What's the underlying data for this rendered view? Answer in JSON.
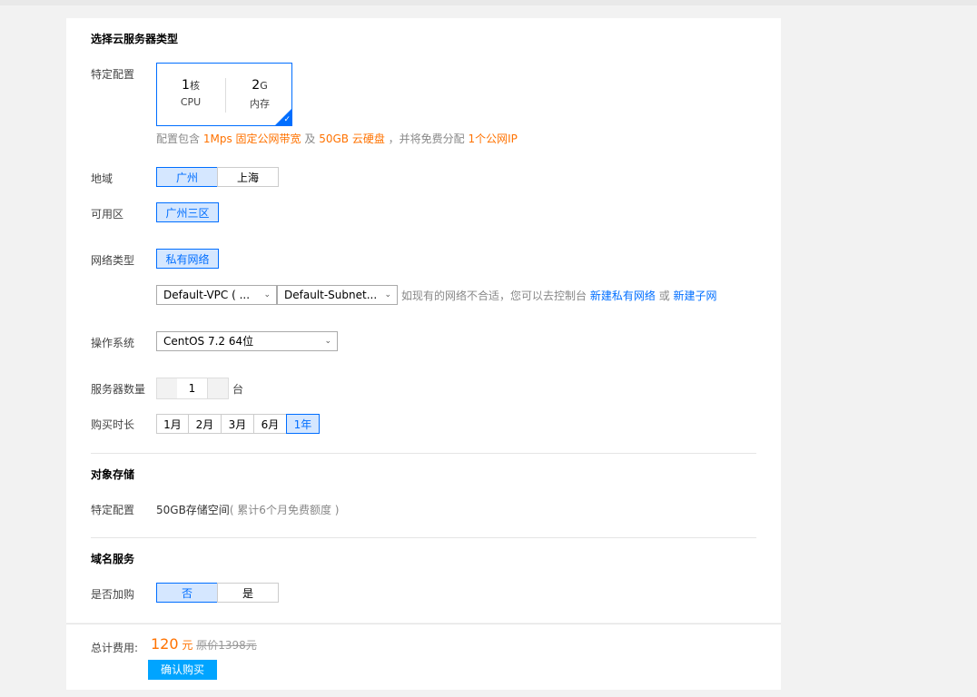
{
  "server": {
    "title": "选择云服务器类型",
    "spec_label": "特定配置",
    "cpu_value": "1",
    "cpu_unit": "核",
    "cpu_label": "CPU",
    "mem_value": "2",
    "mem_unit": "G",
    "mem_label": "内存",
    "note_prefix": "配置包含",
    "note_bandwidth": "1Mps 固定公网带宽",
    "note_and": "及",
    "note_disk": "50GB 云硬盘",
    "note_mid": "，并将免费分配",
    "note_ip": "1个公网IP"
  },
  "region": {
    "label": "地域",
    "options": [
      "广州",
      "上海"
    ],
    "selected": "广州"
  },
  "zone": {
    "label": "可用区",
    "options": [
      "广州三区"
    ],
    "selected": "广州三区"
  },
  "network": {
    "label": "网络类型",
    "options": [
      "私有网络"
    ],
    "selected": "私有网络",
    "vpc_select": "Default-VPC ( ...",
    "subnet_select": "Default-Subnet...",
    "hint": "如现有的网络不合适，您可以去控制台",
    "link_vpc": "新建私有网络",
    "hint_or": "或",
    "link_subnet": "新建子网"
  },
  "os": {
    "label": "操作系统",
    "selected": "CentOS 7.2 64位"
  },
  "quantity": {
    "label": "服务器数量",
    "value": "1",
    "unit": "台"
  },
  "duration": {
    "label": "购买时长",
    "options": [
      "1月",
      "2月",
      "3月",
      "6月",
      "1年"
    ],
    "selected": "1年"
  },
  "storage": {
    "title": "对象存储",
    "spec_label": "特定配置",
    "value": "50GB存储空间",
    "note": "( 累计6个月免费额度 )"
  },
  "domain": {
    "title": "域名服务",
    "label": "是否加购",
    "options": [
      "否",
      "是"
    ],
    "selected": "否"
  },
  "footer": {
    "total_label": "总计费用:",
    "price": "120",
    "price_unit": "元",
    "original_label": "原价",
    "original_price": "1398元",
    "buy_button": "确认购买"
  },
  "colors": {
    "accent": "#006eff",
    "highlight": "#ff7200",
    "buy_button": "#00a4ff"
  }
}
